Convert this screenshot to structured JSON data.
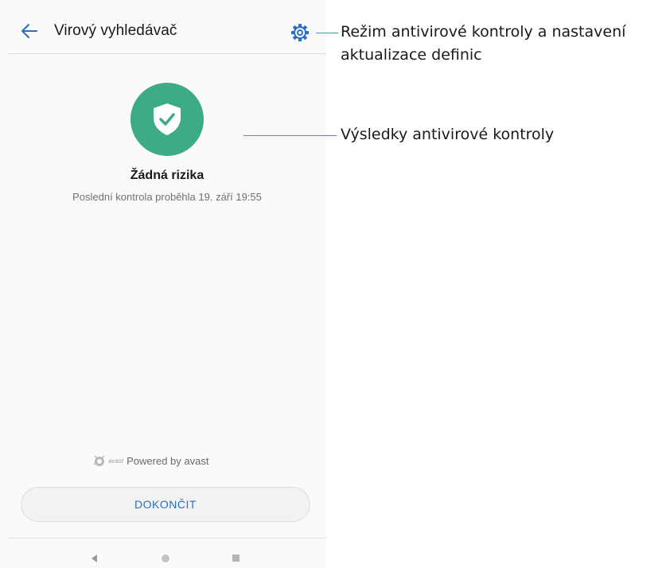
{
  "app": {
    "title": "Virový vyhledávač"
  },
  "status": {
    "title": "Žádná rizika",
    "subtitle": "Poslední kontrola proběhla 19. září 19:55"
  },
  "footer": {
    "brand_word": "avast",
    "powered_text": "Powered by avast",
    "done_label": "DOKONČIT"
  },
  "annotations": {
    "settings_line1": "Režim antivirové kontroly a nastavení",
    "settings_line2": "aktualizace definic",
    "results": "Výsledky antivirové kontroly"
  },
  "icons": {
    "back": "arrow-left-icon",
    "settings": "gear-icon",
    "status": "shield-check-icon",
    "brand": "avast-logo-icon",
    "nav_back": "triangle-back-icon",
    "nav_home": "circle-home-icon",
    "nav_recent": "square-recent-icon"
  },
  "colors": {
    "accent": "#2b6ec4",
    "status_green": "#3dab84",
    "annotation_line": "#3a9aa6"
  }
}
